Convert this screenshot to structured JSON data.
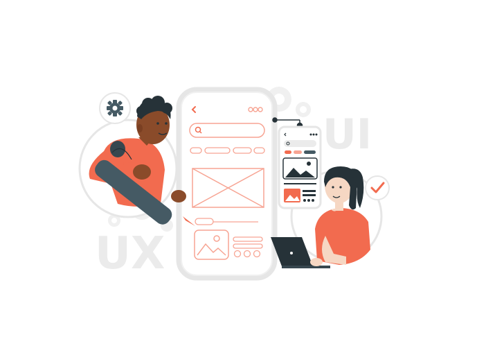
{
  "illustration": {
    "background_text": {
      "ui": "UI",
      "ux": "UX"
    },
    "colors": {
      "accent": "#f26b4f",
      "accent_light": "#f7a493",
      "dark": "#263238",
      "skin_dark": "#8a4b2a",
      "skin_light": "#f6d7c3",
      "phone_frame": "#e6e6e6",
      "decor_gray": "#ebebeb"
    },
    "icons": [
      "gear-icon",
      "checkmark-icon",
      "pencil-icon",
      "laptop-icon",
      "image-icon",
      "search-icon",
      "back-arrow-icon",
      "menu-dots-icon"
    ]
  }
}
